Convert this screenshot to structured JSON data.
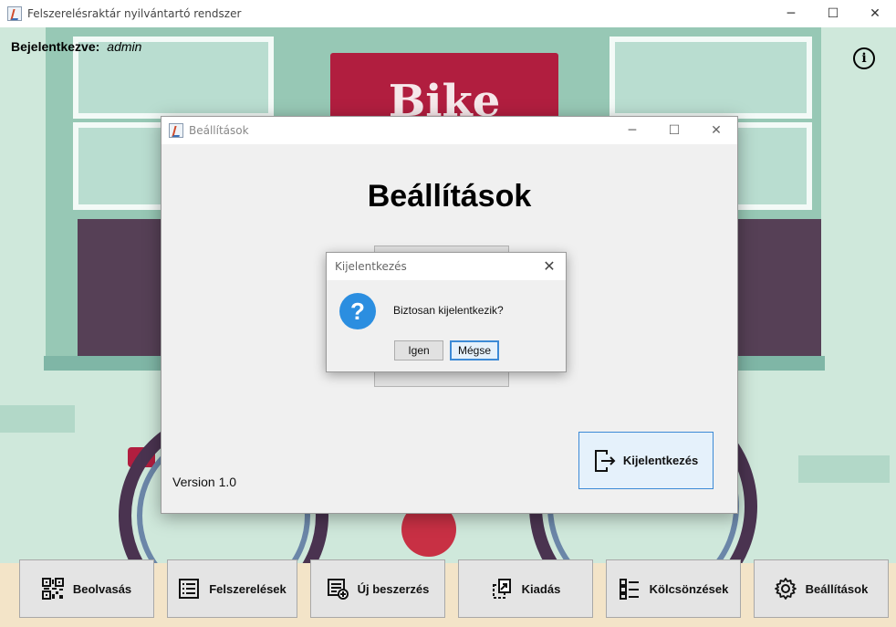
{
  "window": {
    "title": "Felszerelésraktár nyilvántartó rendszer",
    "controls": [
      "─",
      "☐",
      "✕"
    ]
  },
  "status": {
    "label": "Bejelentkezve:",
    "user": "admin"
  },
  "background": {
    "sign_text": "Bike"
  },
  "nav": {
    "items": [
      {
        "label": "Beolvasás",
        "icon": "qr-code-icon"
      },
      {
        "label": "Felszerelések",
        "icon": "list-icon"
      },
      {
        "label": "Új beszerzés",
        "icon": "add-list-icon"
      },
      {
        "label": "Kiadás",
        "icon": "handout-icon"
      },
      {
        "label": "Kölcsönzések",
        "icon": "checklist-icon"
      },
      {
        "label": "Beállítások",
        "icon": "gear-icon"
      }
    ]
  },
  "settings_dialog": {
    "window_title": "Beállítások",
    "heading": "Beállítások",
    "version": "Version 1.0",
    "logout_label": "Kijelentkezés"
  },
  "confirm_dialog": {
    "title": "Kijelentkezés",
    "message": "Biztosan kijelentkezik?",
    "yes_label": "Igen",
    "no_label": "Mégse",
    "icon": "question-icon"
  },
  "colors": {
    "accent_blue": "#3c8ad6",
    "question_blue": "#2b8ee0",
    "sign_red": "#b11e3f"
  }
}
